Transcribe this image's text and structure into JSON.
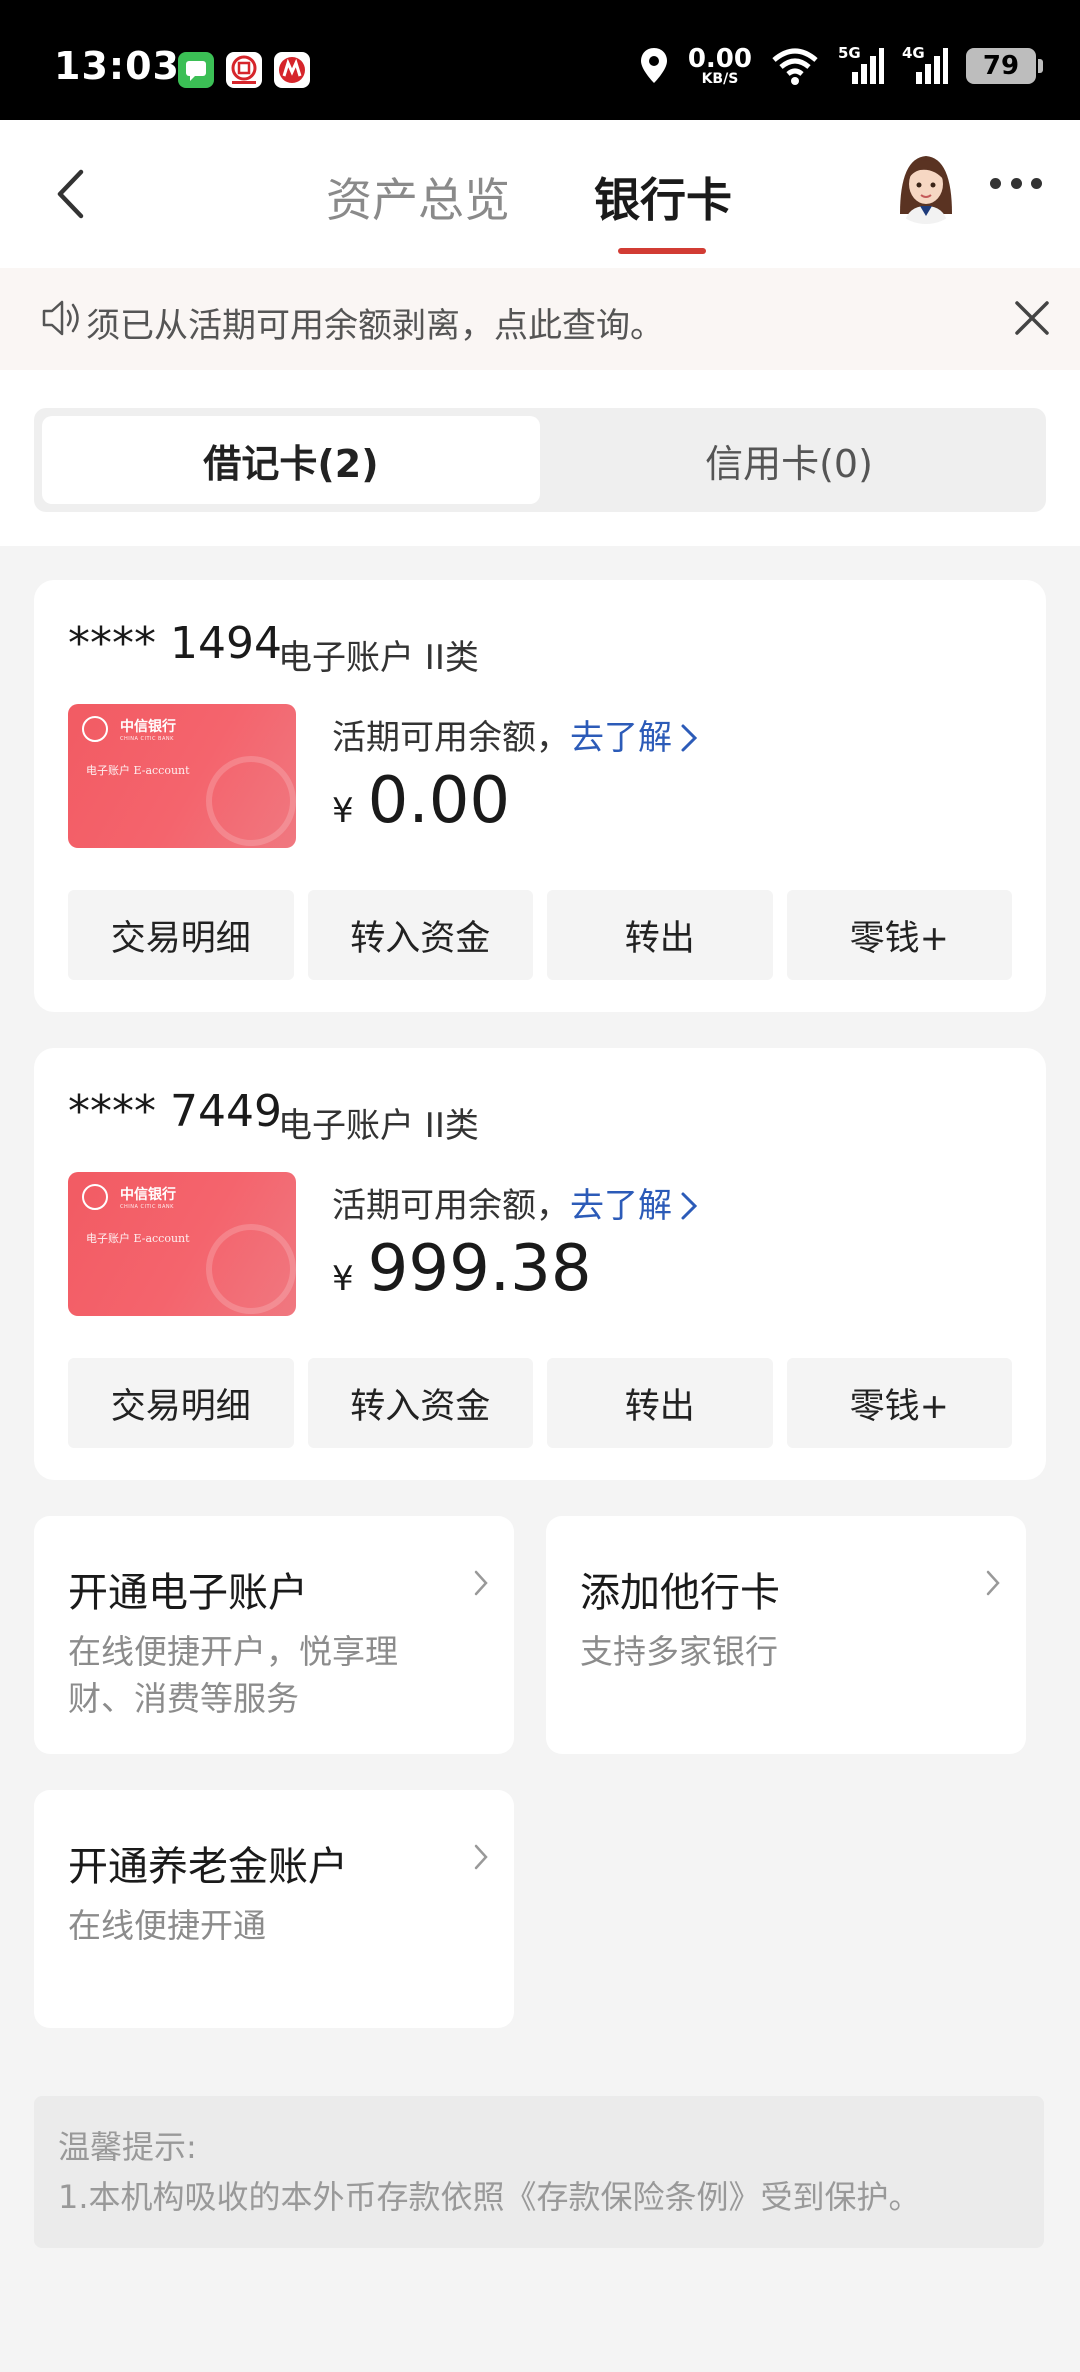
{
  "status_bar": {
    "time": "13:03",
    "net_speed_value": "0.00",
    "net_speed_unit": "KB/S",
    "signal1_gen": "5G",
    "signal2_gen": "4G",
    "battery": "79"
  },
  "nav": {
    "tab_overview": "资产总览",
    "tab_bank_card": "银行卡"
  },
  "notice": {
    "text": "须已从活期可用余额剥离，点此查询。"
  },
  "segment": {
    "debit": "借记卡(2)",
    "credit": "信用卡(0)"
  },
  "accounts": [
    {
      "number": "**** 1494",
      "type": "电子账户 II类",
      "balance_label": "活期可用余额，",
      "learn_more": "去了解",
      "currency": "¥",
      "balance": "0.00",
      "card_bank": "中信银行",
      "card_bank_en": "CHINA CITIC BANK",
      "card_type": "电子账户 E-account",
      "actions": [
        "交易明细",
        "转入资金",
        "转出",
        "零钱+"
      ]
    },
    {
      "number": "**** 7449",
      "type": "电子账户 II类",
      "balance_label": "活期可用余额，",
      "learn_more": "去了解",
      "currency": "¥",
      "balance": "999.38",
      "card_bank": "中信银行",
      "card_bank_en": "CHINA CITIC BANK",
      "card_type": "电子账户 E-account",
      "actions": [
        "交易明细",
        "转入资金",
        "转出",
        "零钱+"
      ]
    }
  ],
  "services": [
    {
      "title": "开通电子账户",
      "desc": "在线便捷开户，悦享理财、消费等服务"
    },
    {
      "title": "添加他行卡",
      "desc": "支持多家银行"
    },
    {
      "title": "开通养老金账户",
      "desc": "在线便捷开通"
    }
  ],
  "tips": {
    "title": "温馨提示:",
    "body": "1.本机构吸收的本外币存款依照《存款保险条例》受到保护。"
  },
  "colors": {
    "accent_red": "#d23c34",
    "link_blue": "#2c5bb8",
    "card_red": "#f25b63"
  }
}
